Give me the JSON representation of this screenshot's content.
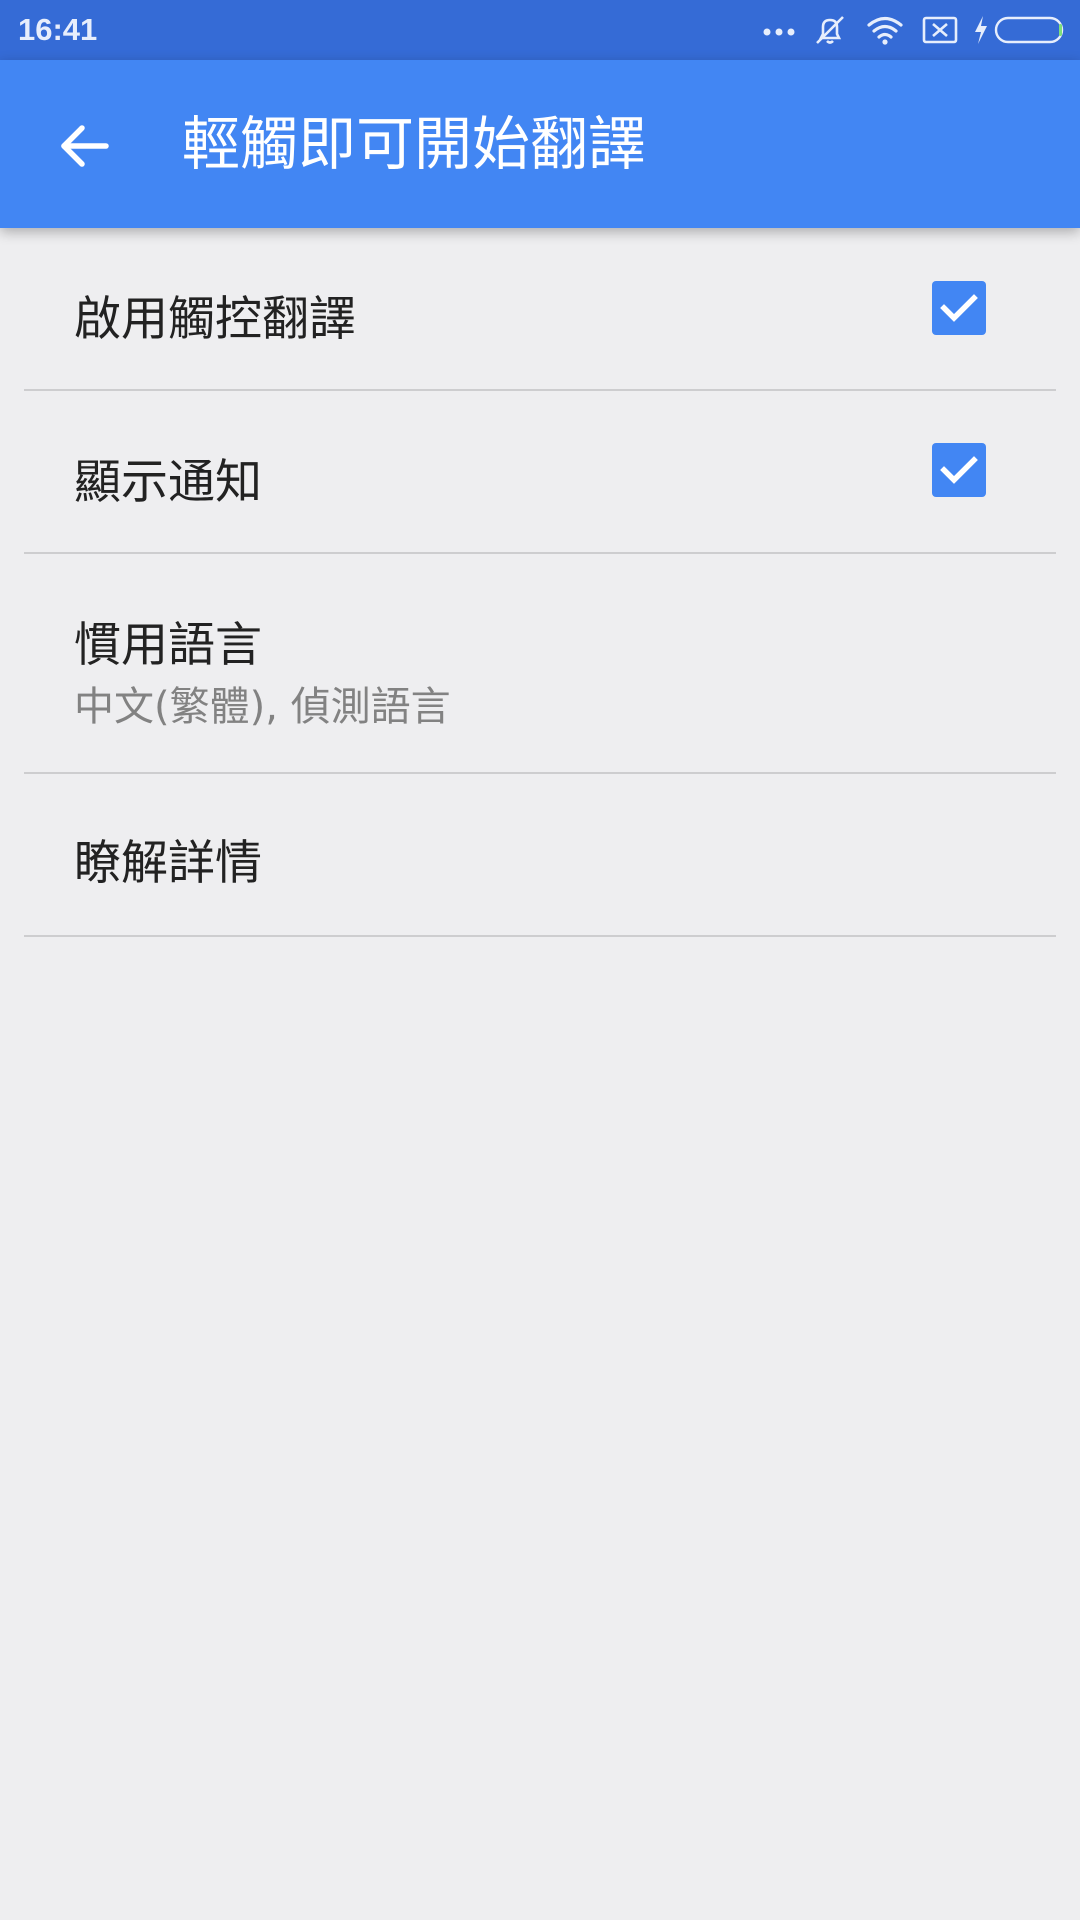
{
  "status_bar": {
    "time": "16:41",
    "icons": [
      "more-dots-icon",
      "vibrate-off-icon",
      "wifi-icon",
      "sim-x-icon",
      "charging-icon",
      "battery-icon"
    ]
  },
  "app_bar": {
    "title": "輕觸即可開始翻譯",
    "back_icon": "arrow-back-icon",
    "background": "#4286f3"
  },
  "settings": {
    "enable_tap": {
      "label": "啟用觸控翻譯",
      "checked": true
    },
    "show_notification": {
      "label": "顯示通知",
      "checked": true
    },
    "preferred_languages": {
      "label": "慣用語言",
      "value": "中文(繁體), 偵測語言"
    },
    "learn_more": {
      "label": "瞭解詳情"
    }
  },
  "colors": {
    "accent": "#4286f3",
    "status_bar": "#356bd6",
    "background": "#eeeef0"
  }
}
